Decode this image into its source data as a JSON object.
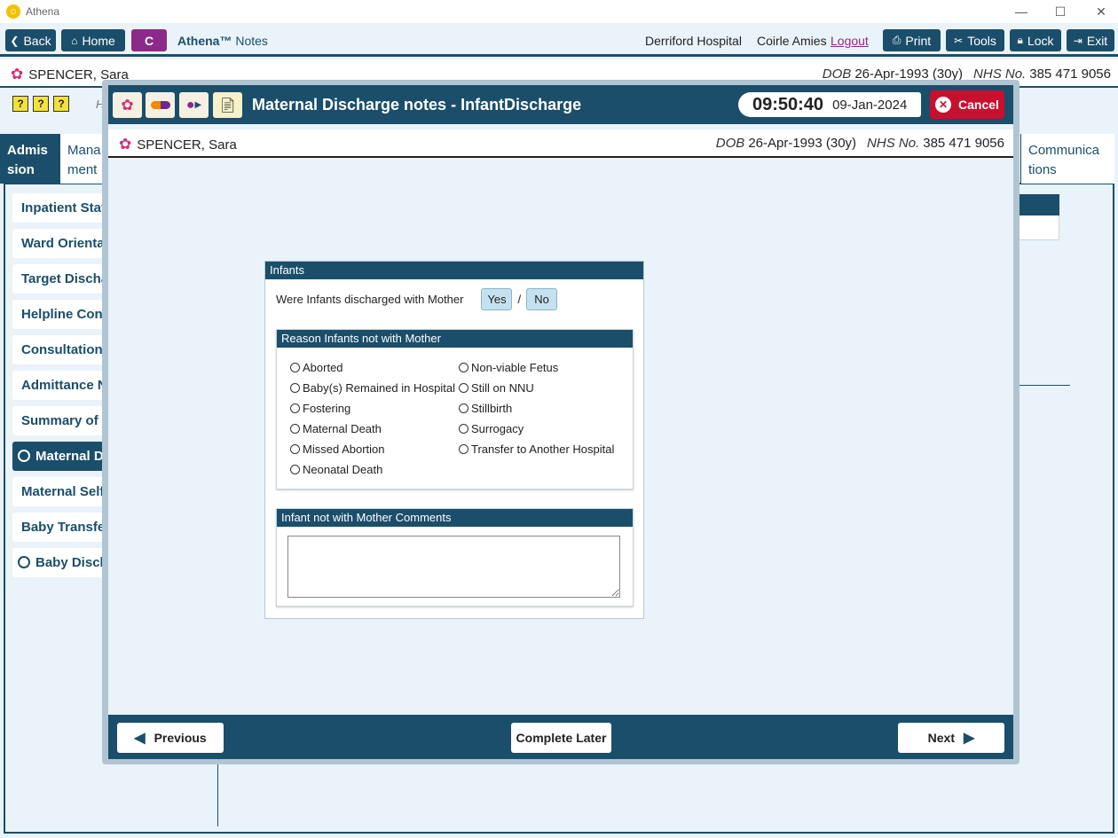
{
  "window": {
    "title": "Athena",
    "min_icon": "minimize-icon",
    "max_icon": "maximize-icon",
    "close_icon": "close-icon"
  },
  "toolbar": {
    "back": "Back",
    "home": "Home",
    "c": "C",
    "app_name": "Athena™",
    "app_sub": "Notes",
    "hospital": "Derriford Hospital",
    "user": "Coirle Amies",
    "logout": "Logout",
    "print": "Print",
    "tools": "Tools",
    "lock": "Lock",
    "exit": "Exit"
  },
  "patient": {
    "name": "SPENCER, Sara",
    "dob_label": "DOB",
    "dob": "26-Apr-1993 (30y)",
    "nhs_label": "NHS No.",
    "nhs": "385 471 9056"
  },
  "bg": {
    "h_text": "H",
    "tab_active": "Admis sion",
    "tab_manage": "Mana ment",
    "tab_comm": "Communica tions",
    "side": [
      "Inpatient Stay",
      "Ward Orientat",
      "Target Dischar",
      "Helpline Cont",
      "Consultation I",
      "Admittance N",
      "Summary of P",
      "Maternal Di",
      "Maternal Self",
      "Baby Transfer",
      "Baby Discha"
    ]
  },
  "modal": {
    "title": "Maternal Discharge notes - InfantDischarge",
    "time": "09:50:40",
    "date": "09-Jan-2024",
    "cancel": "Cancel",
    "section_title": "Infants",
    "question": "Were Infants discharged with Mother",
    "yes": "Yes",
    "sep": "/",
    "no": "No",
    "reason_title": "Reason Infants not with Mother",
    "reasons_left": [
      "Aborted",
      "Baby(s) Remained in Hospital",
      "Fostering",
      "Maternal Death",
      "Missed Abortion",
      "Neonatal Death"
    ],
    "reasons_right": [
      "Non-viable Fetus",
      "Still on NNU",
      "Stillbirth",
      "Surrogacy",
      "Transfer to Another Hospital"
    ],
    "comments_title": "Infant not with Mother Comments",
    "comments_value": "",
    "previous": "Previous",
    "complete_later": "Complete Later",
    "next": "Next"
  },
  "colors": {
    "primary": "#1b4e6b",
    "accent": "#8b2a8a",
    "cancel": "#c8102e",
    "background": "#eaf3fa"
  }
}
